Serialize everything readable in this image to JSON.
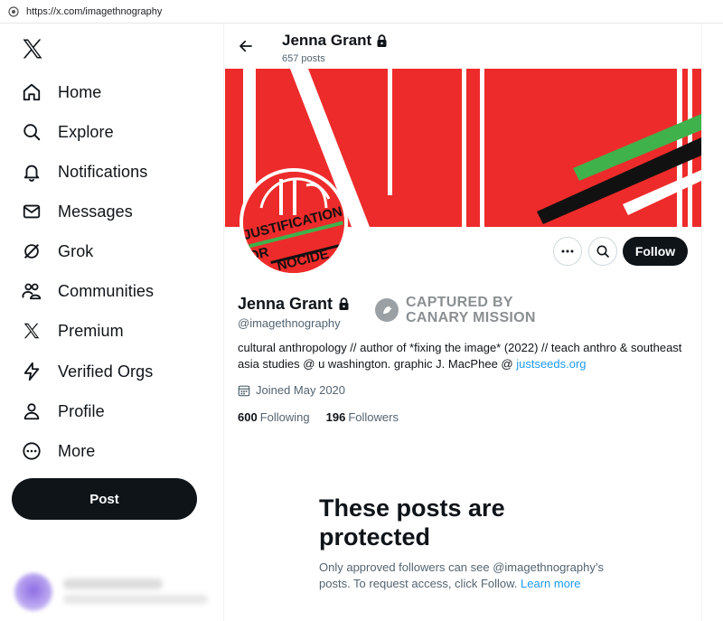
{
  "browser": {
    "url": "https://x.com/imagethnography"
  },
  "sidebar": {
    "logo": "x-logo-icon",
    "items": [
      {
        "label": "Home",
        "icon": "home-icon"
      },
      {
        "label": "Explore",
        "icon": "search-icon"
      },
      {
        "label": "Notifications",
        "icon": "bell-icon"
      },
      {
        "label": "Messages",
        "icon": "envelope-icon"
      },
      {
        "label": "Grok",
        "icon": "grok-icon"
      },
      {
        "label": "Communities",
        "icon": "people-icon"
      },
      {
        "label": "Premium",
        "icon": "x-logo-icon"
      },
      {
        "label": "Verified Orgs",
        "icon": "lightning-icon"
      },
      {
        "label": "Profile",
        "icon": "person-icon"
      },
      {
        "label": "More",
        "icon": "more-circle-icon"
      }
    ],
    "post_label": "Post"
  },
  "header": {
    "name": "Jenna Grant",
    "post_count": "657 posts"
  },
  "banner": {
    "avatar_text_line1": "JUSTIFICATION",
    "avatar_text_line2": "OR",
    "avatar_text_line3": "NOCIDE"
  },
  "profile": {
    "name": "Jenna Grant",
    "handle": "@imagethnography",
    "bio_text": "cultural anthropology // author of *fixing the image* (2022) // teach anthro & southeast asia studies @ u washington. graphic J. MacPhee @ ",
    "bio_link": "justseeds.org",
    "joined": "Joined May 2020",
    "following_count": "600",
    "following_label": "Following",
    "followers_count": "196",
    "followers_label": "Followers",
    "follow_label": "Follow"
  },
  "watermark": {
    "line1": "CAPTURED BY",
    "line2": "CANARY MISSION"
  },
  "protected": {
    "title": "These posts are protected",
    "desc": "Only approved followers can see @imagethnography’s posts. To request access, click Follow. ",
    "link": "Learn more"
  },
  "colors": {
    "accent": "#1d9bf0",
    "banner_red": "#ee2b2b",
    "banner_green": "#3fb24b",
    "text": "#0f1419",
    "muted": "#536471"
  }
}
